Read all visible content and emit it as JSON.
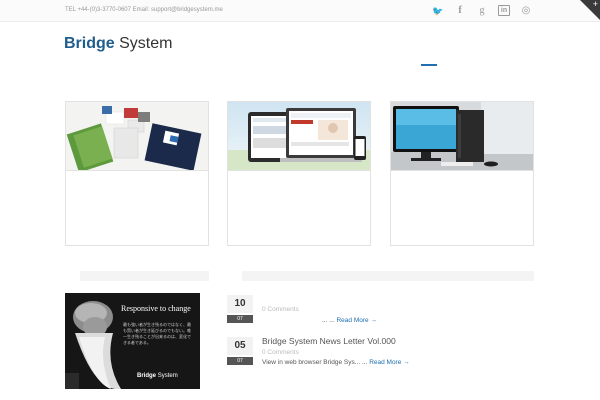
{
  "topbar": {
    "contact": "TEL +44-(0)3-3770-0607 Email: support@bridgesystem.me",
    "social": [
      {
        "icon": "twitter-icon",
        "glyph": "🐦"
      },
      {
        "icon": "facebook-icon",
        "glyph": "f"
      },
      {
        "icon": "google-plus-icon",
        "glyph": "g"
      },
      {
        "icon": "linkedin-icon",
        "glyph": "in"
      },
      {
        "icon": "rss-icon",
        "glyph": "◎"
      }
    ],
    "corner_glyph": "+"
  },
  "logo": {
    "brand": "Bridge",
    "suffix": "System"
  },
  "colors": {
    "accent": "#1f6fb1",
    "logo": "#1f5d8c"
  },
  "promo": {
    "title": "Responsive to change",
    "jp_text": "最も強い者が生き残るのではなく、最も賢い者が生き延びるのでもない。唯一生き残ることが出来るのは、変化できる者である。",
    "brand_bold": "Bridge",
    "brand_rest": "System"
  },
  "news": [
    {
      "day": "10",
      "month": "07",
      "title": "",
      "comments": "0 Comments",
      "excerpt": "... ...",
      "read_more": "Read More →"
    },
    {
      "day": "05",
      "month": "07",
      "title": "Bridge System News Letter Vol.000",
      "comments": "0 Comments",
      "excerpt": "View in web browser Bridge Sys... ...",
      "read_more": "Read More →"
    }
  ]
}
